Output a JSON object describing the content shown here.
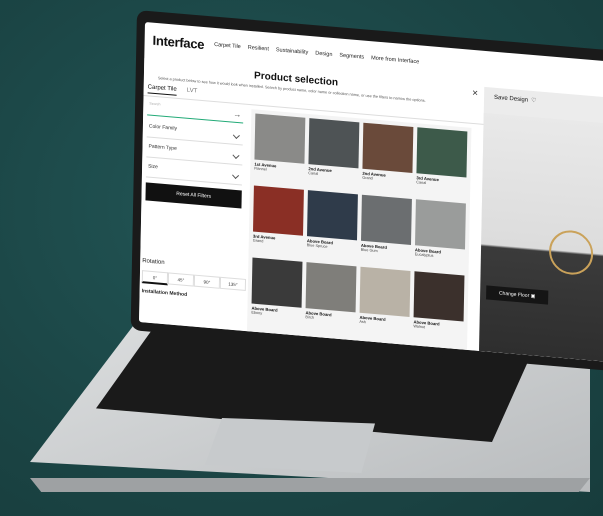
{
  "nav": {
    "logo": "Interface",
    "items": [
      "Carpet Tile",
      "Resilient",
      "Sustainability",
      "Design",
      "Segments",
      "More from Interface"
    ]
  },
  "panel": {
    "title": "Product selection",
    "subtitle": "Select a product below to see how it would look when installed. Search by product name, color name or collection name, or use the filters to narrow the options.",
    "close": "×",
    "tabs": [
      "Carpet Tile",
      "LVT"
    ],
    "search_placeholder": "Search",
    "filters": [
      "Color Family",
      "Pattern Type",
      "Size"
    ],
    "reset_label": "Reset All Filters",
    "rotation_label": "Rotation",
    "rotation_options": [
      "0°",
      "45°",
      "90°",
      "135°"
    ],
    "installation_label": "Installation Method"
  },
  "products": [
    {
      "name": "1st Avenue",
      "color": "Flannel",
      "hex": "#8a8a88"
    },
    {
      "name": "2nd Avenue",
      "color": "Canal",
      "hex": "#4e5355"
    },
    {
      "name": "2nd Avenue",
      "color": "Grand",
      "hex": "#6a4a3a"
    },
    {
      "name": "3rd Avenue",
      "color": "Canal",
      "hex": "#3d5a4a"
    },
    {
      "name": "3rd Avenue",
      "color": "Grand",
      "hex": "#8a2f25"
    },
    {
      "name": "Above Board",
      "color": "Blue Spruce",
      "hex": "#2f3b4a"
    },
    {
      "name": "Above Board",
      "color": "Blue Gum",
      "hex": "#6b6e70"
    },
    {
      "name": "Above Board",
      "color": "Eucalyptus",
      "hex": "#9a9c9b"
    },
    {
      "name": "Above Board",
      "color": "Ebony",
      "hex": "#3a3a3a"
    },
    {
      "name": "Above Board",
      "color": "Birch",
      "hex": "#7f7e7a"
    },
    {
      "name": "Above Board",
      "color": "Ash",
      "hex": "#b9b2a6"
    },
    {
      "name": "Above Board",
      "color": "Walnut",
      "hex": "#3b302c"
    }
  ],
  "right": {
    "save_label": "Save Design",
    "change_floor_label": "Change Floor"
  }
}
